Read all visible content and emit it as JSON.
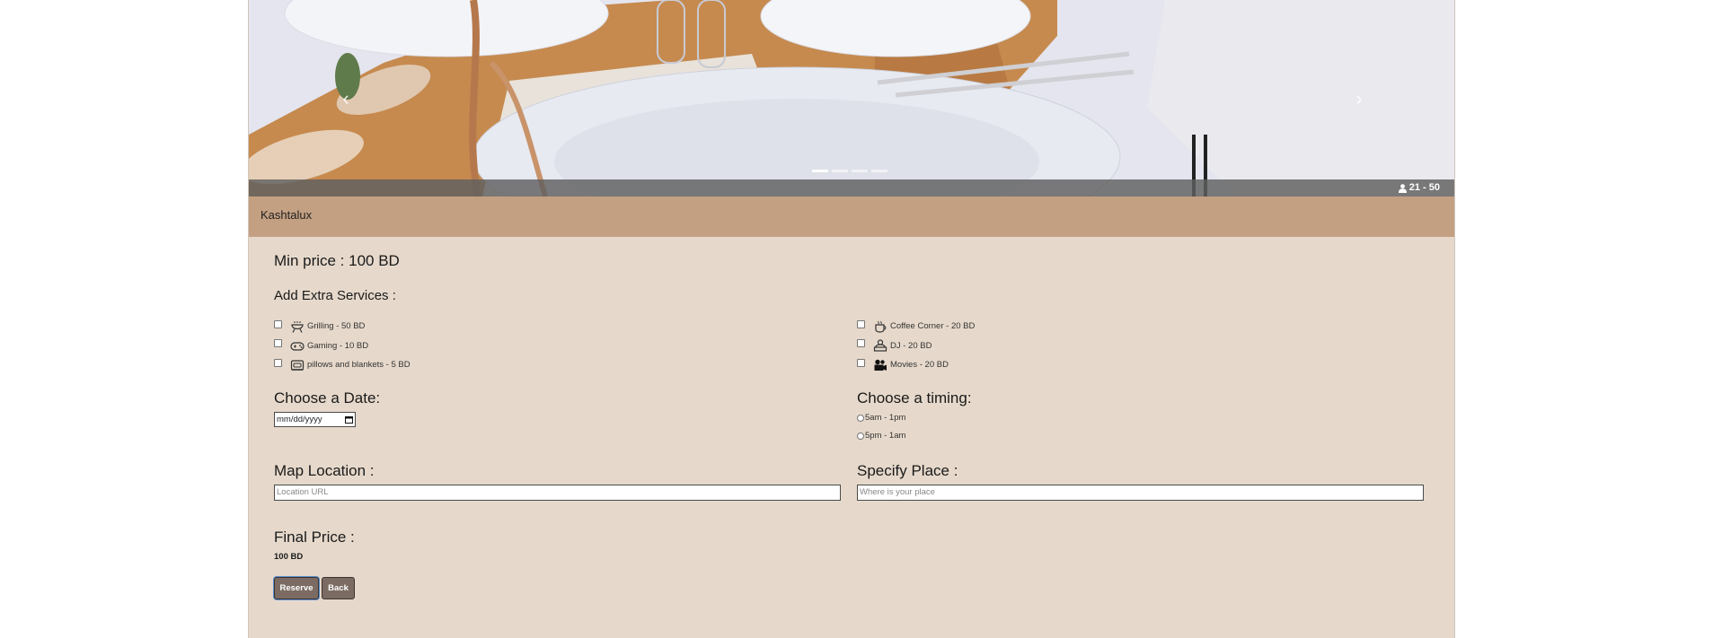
{
  "hero": {
    "capacity": "21 - 50",
    "slide_count": 4,
    "active_slide": 1,
    "prev_arrow": "‹",
    "next_arrow": "›"
  },
  "venue": {
    "name": "Kashtalux"
  },
  "min_price": "Min price : 100 BD",
  "extras": {
    "title": "Add Extra Services :",
    "left": [
      {
        "label": "Grilling - 50 BD",
        "icon": "grill-icon"
      },
      {
        "label": "Gaming - 10 BD",
        "icon": "gamepad-icon"
      },
      {
        "label": "pillows and blankets - 5 BD",
        "icon": "pillow-icon"
      }
    ],
    "right": [
      {
        "label": "Coffee Corner - 20 BD",
        "icon": "coffee-icon"
      },
      {
        "label": "DJ - 20 BD",
        "icon": "dj-icon"
      },
      {
        "label": "Movies - 20 BD",
        "icon": "movie-camera-icon"
      }
    ]
  },
  "date": {
    "title": "Choose a Date:",
    "placeholder": "mm/dd/yyyy"
  },
  "timing": {
    "title": "Choose a timing:",
    "options": [
      "5am - 1pm",
      "5pm - 1am"
    ]
  },
  "map": {
    "title": "Map Location :",
    "placeholder": "Location URL"
  },
  "place": {
    "title": "Specify Place :",
    "placeholder": "Where is your place"
  },
  "final": {
    "title": "Final Price :",
    "value": "100 BD"
  },
  "buttons": {
    "reserve": "Reserve",
    "back": "Back"
  },
  "colors": {
    "header": "#c4a083",
    "body_bg": "#e6d9cb",
    "button": "#7b6b62"
  }
}
